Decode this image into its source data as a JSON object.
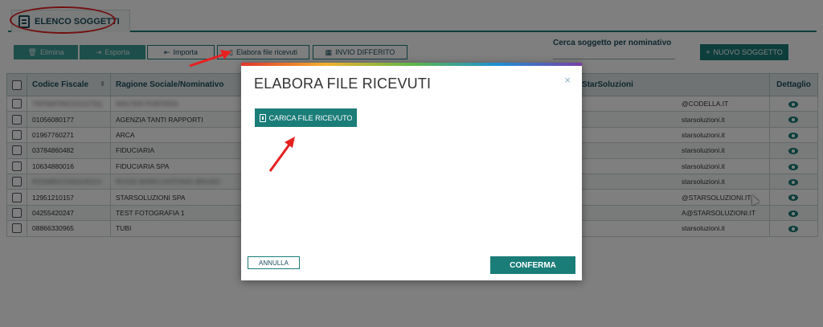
{
  "tab": {
    "label": "ELENCO SOGGETTI",
    "icon": "list-doc-icon"
  },
  "toolbar": {
    "delete_label": "Elimina",
    "export_label": "Esporta",
    "import_label": "Importa",
    "process_label": "Elabora file ricevuti",
    "deferred_label": "INVIO DIFFERITO"
  },
  "search": {
    "label": "Cerca soggetto per nominativo",
    "value": ""
  },
  "new_subject_label": "NUOVO SOGGETTO",
  "table": {
    "columns": [
      "Codice Fiscale",
      "Ragione Sociale/Nominativo",
      "StarSoluzioni",
      "Dettaglio"
    ],
    "rows": [
      {
        "cf": "TRFNMT85C01G273Q",
        "name": "WALTER PORTERA",
        "contact": "@CODELLA.IT",
        "blur_cf": true,
        "blur_name": true
      },
      {
        "cf": "01056080177",
        "name": "AGENZIA TANTI RAPPORTI",
        "contact": "starsoluzioni.it"
      },
      {
        "cf": "01967760271",
        "name": "ARCA",
        "contact": "starsoluzioni.it"
      },
      {
        "cf": "03784860482",
        "name": "FIDUCIARIA",
        "contact": "starsoluzioni.it"
      },
      {
        "cf": "10634880016",
        "name": "FIDUCIARIA SPA",
        "contact": "starsoluzioni.it"
      },
      {
        "cf": "RSSMRA70A01H501X",
        "name": "ROSSI MARIO ANTONIO BRUNO",
        "contact": "starsoluzioni.it",
        "blur_cf": true,
        "blur_name": true
      },
      {
        "cf": "12951210157",
        "name": "STARSOLUZIONI SPA",
        "contact": "@STARSOLUZIONI.IT"
      },
      {
        "cf": "04255420247",
        "name": "TEST FOTOGRAFIA 1",
        "contact": "A@STARSOLUZIONI.IT"
      },
      {
        "cf": "08866330965",
        "name": "TUBI",
        "contact": "starsoluzioni.it"
      }
    ]
  },
  "modal": {
    "title": "ELABORA FILE RICEVUTI",
    "close_glyph": "×",
    "upload_label": "CARICA FILE RICEVUTO",
    "cancel_label": "ANNULLA",
    "confirm_label": "CONFERMA"
  },
  "colors": {
    "accent": "#1a7d78",
    "annotation": "#e62020"
  }
}
